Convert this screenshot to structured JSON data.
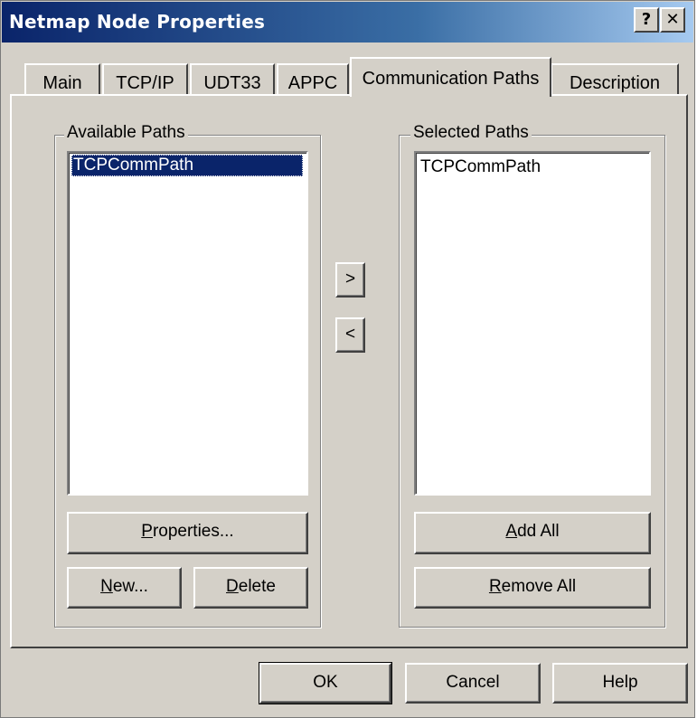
{
  "window": {
    "title": "Netmap Node Properties"
  },
  "titlebar_buttons": {
    "help": "?",
    "close": "✕"
  },
  "tabs": [
    {
      "label": "Main"
    },
    {
      "label": "TCP/IP"
    },
    {
      "label": "UDT33"
    },
    {
      "label": "APPC"
    },
    {
      "label": "Communication Paths"
    },
    {
      "label": "Description"
    }
  ],
  "active_tab": "Communication Paths",
  "available": {
    "label": "Available Paths",
    "items": [
      "TCPCommPath"
    ],
    "selected_item": "TCPCommPath",
    "properties_prefix": "",
    "properties_key": "P",
    "properties_rest": "roperties...",
    "new_key": "N",
    "new_rest": "ew...",
    "delete_key": "D",
    "delete_rest": "elete"
  },
  "selected": {
    "label": "Selected Paths",
    "items": [
      "TCPCommPath"
    ],
    "addall_key": "A",
    "addall_rest": "dd All",
    "removeall_key": "R",
    "removeall_rest": "emove All"
  },
  "move": {
    "add": ">",
    "remove": "<"
  },
  "footer": {
    "ok": "OK",
    "cancel": "Cancel",
    "help": "Help"
  },
  "colors": {
    "face": "#d4d0c8",
    "title_start": "#0a246a",
    "title_end": "#a6caf0",
    "selection": "#0a246a"
  }
}
